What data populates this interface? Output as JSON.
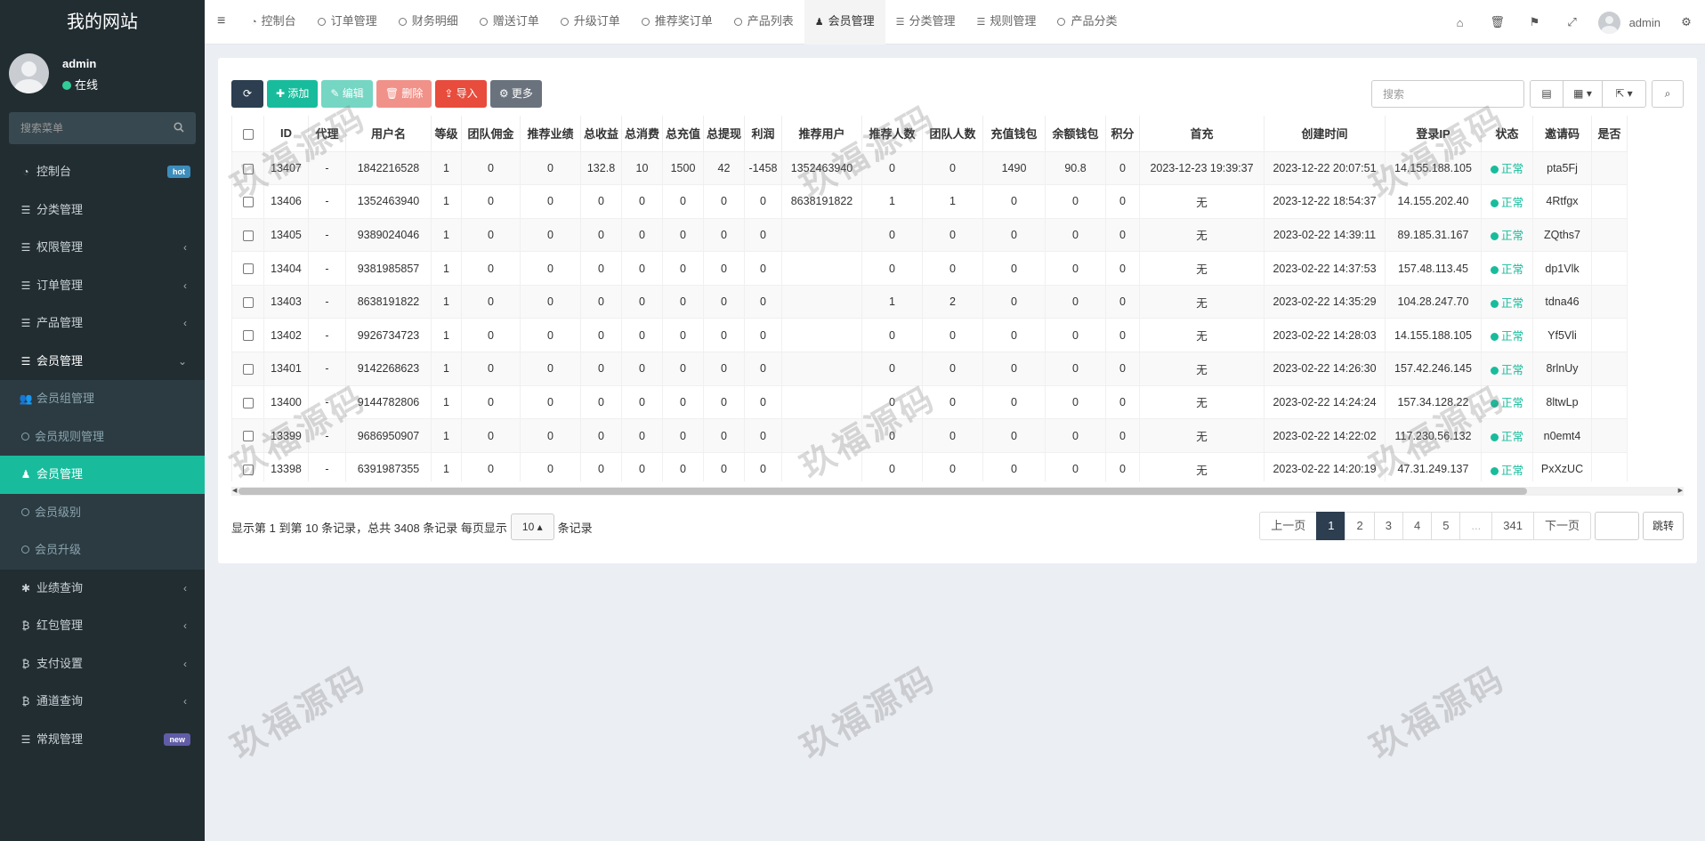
{
  "site": {
    "title": "我的网站"
  },
  "user": {
    "name": "admin",
    "status": "在线"
  },
  "sidebar": {
    "search_placeholder": "搜索菜单",
    "items": [
      {
        "label": "控制台",
        "icon": "dashboard-icon",
        "badge": "hot"
      },
      {
        "label": "分类管理",
        "icon": "list-icon"
      },
      {
        "label": "权限管理",
        "icon": "list-icon",
        "arrow": "‹"
      },
      {
        "label": "订单管理",
        "icon": "list-icon",
        "arrow": "‹"
      },
      {
        "label": "产品管理",
        "icon": "list-icon",
        "arrow": "‹"
      },
      {
        "label": "会员管理",
        "icon": "list-icon",
        "arrow": "⌄"
      }
    ],
    "sub_items": [
      {
        "label": "会员组管理"
      },
      {
        "label": "会员规则管理"
      },
      {
        "label": "会员管理"
      },
      {
        "label": "会员级别"
      },
      {
        "label": "会员升级"
      }
    ],
    "items_after": [
      {
        "label": "业绩查询",
        "arrow": "‹"
      },
      {
        "label": "红包管理",
        "arrow": "‹"
      },
      {
        "label": "支付设置",
        "arrow": "‹"
      },
      {
        "label": "通道查询",
        "arrow": "‹"
      },
      {
        "label": "常规管理",
        "badge": "new"
      }
    ]
  },
  "tabs": [
    "控制台",
    "订单管理",
    "财务明细",
    "赠送订单",
    "升级订单",
    "推荐奖订单",
    "产品列表",
    "会员管理",
    "分类管理",
    "规则管理",
    "产品分类"
  ],
  "nav_user": "admin",
  "toolbar": {
    "add": "添加",
    "edit": "编辑",
    "delete": "删除",
    "import": "导入",
    "more": "更多",
    "search_placeholder": "搜索"
  },
  "table": {
    "headers": [
      "ID",
      "代理",
      "用户名",
      "等级",
      "团队佣金",
      "推荐业绩",
      "总收益",
      "总消费",
      "总充值",
      "总提现",
      "利润",
      "推荐用户",
      "推荐人数",
      "团队人数",
      "充值钱包",
      "余额钱包",
      "积分",
      "首充",
      "创建时间",
      "登录IP",
      "状态",
      "邀请码",
      "是否"
    ],
    "rows": [
      [
        "13407",
        "-",
        "1842216528",
        "1",
        "0",
        "0",
        "132.8",
        "10",
        "1500",
        "42",
        "-1458",
        "1352463940",
        "0",
        "0",
        "1490",
        "90.8",
        "0",
        "2023-12-23 19:39:37",
        "2023-12-22 20:07:51",
        "14.155.188.105",
        "正常",
        "pta5Fj",
        ""
      ],
      [
        "13406",
        "-",
        "1352463940",
        "1",
        "0",
        "0",
        "0",
        "0",
        "0",
        "0",
        "0",
        "8638191822",
        "1",
        "1",
        "0",
        "0",
        "0",
        "无",
        "2023-12-22 18:54:37",
        "14.155.202.40",
        "正常",
        "4Rtfgx",
        ""
      ],
      [
        "13405",
        "-",
        "9389024046",
        "1",
        "0",
        "0",
        "0",
        "0",
        "0",
        "0",
        "0",
        "",
        "0",
        "0",
        "0",
        "0",
        "0",
        "无",
        "2023-02-22 14:39:11",
        "89.185.31.167",
        "正常",
        "ZQths7",
        ""
      ],
      [
        "13404",
        "-",
        "9381985857",
        "1",
        "0",
        "0",
        "0",
        "0",
        "0",
        "0",
        "0",
        "",
        "0",
        "0",
        "0",
        "0",
        "0",
        "无",
        "2023-02-22 14:37:53",
        "157.48.113.45",
        "正常",
        "dp1Vlk",
        ""
      ],
      [
        "13403",
        "-",
        "8638191822",
        "1",
        "0",
        "0",
        "0",
        "0",
        "0",
        "0",
        "0",
        "",
        "1",
        "2",
        "0",
        "0",
        "0",
        "无",
        "2023-02-22 14:35:29",
        "104.28.247.70",
        "正常",
        "tdna46",
        ""
      ],
      [
        "13402",
        "-",
        "9926734723",
        "1",
        "0",
        "0",
        "0",
        "0",
        "0",
        "0",
        "0",
        "",
        "0",
        "0",
        "0",
        "0",
        "0",
        "无",
        "2023-02-22 14:28:03",
        "14.155.188.105",
        "正常",
        "Yf5Vli",
        ""
      ],
      [
        "13401",
        "-",
        "9142268623",
        "1",
        "0",
        "0",
        "0",
        "0",
        "0",
        "0",
        "0",
        "",
        "0",
        "0",
        "0",
        "0",
        "0",
        "无",
        "2023-02-22 14:26:30",
        "157.42.246.145",
        "正常",
        "8rlnUy",
        ""
      ],
      [
        "13400",
        "-",
        "9144782806",
        "1",
        "0",
        "0",
        "0",
        "0",
        "0",
        "0",
        "0",
        "",
        "0",
        "0",
        "0",
        "0",
        "0",
        "无",
        "2023-02-22 14:24:24",
        "157.34.128.22",
        "正常",
        "8ltwLp",
        ""
      ],
      [
        "13399",
        "-",
        "9686950907",
        "1",
        "0",
        "0",
        "0",
        "0",
        "0",
        "0",
        "0",
        "",
        "0",
        "0",
        "0",
        "0",
        "0",
        "无",
        "2023-02-22 14:22:02",
        "117.230.56.132",
        "正常",
        "n0emt4",
        ""
      ],
      [
        "13398",
        "-",
        "6391987355",
        "1",
        "0",
        "0",
        "0",
        "0",
        "0",
        "0",
        "0",
        "",
        "0",
        "0",
        "0",
        "0",
        "0",
        "无",
        "2023-02-22 14:20:19",
        "47.31.249.137",
        "正常",
        "PxXzUC",
        ""
      ]
    ]
  },
  "pageinfo": {
    "text_before": "显示第 1 到第 10 条记录，总共 3408 条记录 每页显示",
    "page_size": "10",
    "text_after": "条记录"
  },
  "pagination": {
    "prev": "上一页",
    "pages": [
      "1",
      "2",
      "3",
      "4",
      "5",
      "...",
      "341"
    ],
    "next": "下一页",
    "jump": "跳转",
    "current": "1"
  },
  "watermark": "玖福源码",
  "colors": {
    "sidebar": "#222d32",
    "accent": "#18bc9c",
    "primary_dark": "#2c3e50",
    "danger": "#e74c3c"
  }
}
